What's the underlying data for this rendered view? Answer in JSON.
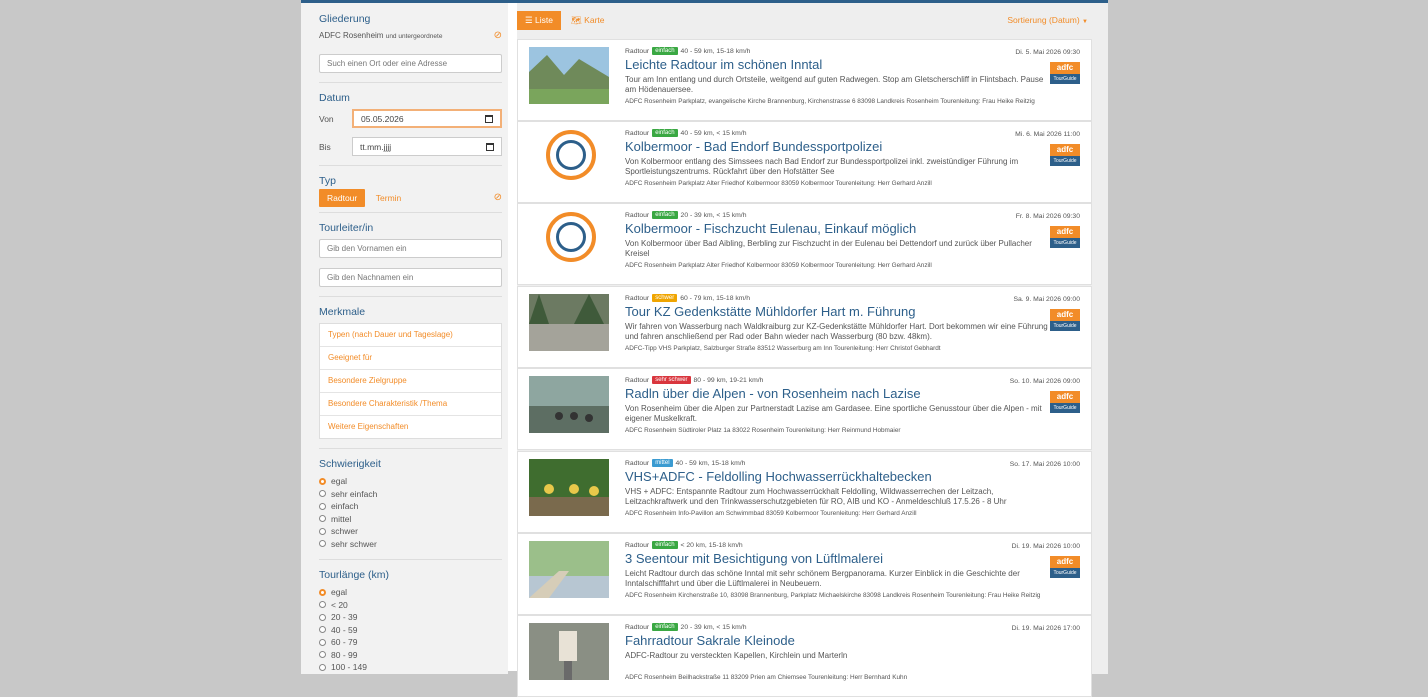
{
  "sidebar": {
    "gliederung_title": "Gliederung",
    "gliederung_value": "ADFC Rosenheim",
    "gliederung_sub": "und untergeordnete",
    "search_placeholder": "Such einen Ort oder eine Adresse",
    "datum_title": "Datum",
    "von_label": "Von",
    "von_value": "05.05.2026",
    "bis_label": "Bis",
    "bis_value": "tt.mm.jjjj",
    "typ_title": "Typ",
    "typ_radtour": "Radtour",
    "typ_termin": "Termin",
    "tourleiter_title": "Tourleiter/in",
    "vorname_placeholder": "Gib den Vornamen ein",
    "nachname_placeholder": "Gib den Nachnamen ein",
    "merkmale_title": "Merkmale",
    "merkmale": [
      "Typen (nach Dauer und Tageslage)",
      "Geeignet für",
      "Besondere Zielgruppe",
      "Besondere Charakteristik /Thema",
      "Weitere Eigenschaften"
    ],
    "schwierigkeit_title": "Schwierigkeit",
    "schwierigkeit": [
      "egal",
      "sehr einfach",
      "einfach",
      "mittel",
      "schwer",
      "sehr schwer"
    ],
    "tourlaenge_title": "Tourlänge (km)",
    "tourlaenge": [
      "egal",
      "< 20",
      "20 - 39",
      "40 - 59",
      "60 - 79",
      "80 - 99",
      "100 - 149"
    ]
  },
  "toolbar": {
    "liste": "Liste",
    "karte": "Karte",
    "sort": "Sortierung (Datum)"
  },
  "tours": [
    {
      "type": "Radtour",
      "badge": "einfach",
      "badge_color": "#3aa843",
      "stats": "40 - 59 km, 15-18 km/h",
      "date": "Di. 5. Mai 2026 09:30",
      "title": "Leichte Radtour im schönen Inntal",
      "desc": "Tour am Inn entlang und durch Ortsteile, weitgend auf guten Radwegen. Stop am Gletscherschliff in Flintsbach. Pause am Hödenauersee.",
      "foot": "ADFC Rosenheim Parkplatz, evangelische Kirche Brannenburg, Kirchenstrasse 6 83098 Landkreis Rosenheim Tourenleitung: Frau Heike Reitzig",
      "img": "mountain",
      "guide": true
    },
    {
      "type": "Radtour",
      "badge": "einfach",
      "badge_color": "#3aa843",
      "stats": "40 - 59 km, < 15 km/h",
      "date": "Mi. 6. Mai 2026 11:00",
      "title": "Kolbermoor - Bad Endorf Bundessportpolizei",
      "desc": "Von Kolbermoor entlang des Simssees nach Bad Endorf zur Bundessportpolizei inkl. zweistündiger Führung im Sportleistungszentrums. Rückfahrt über den Hofstätter See",
      "foot": "ADFC Rosenheim Parkplatz Alter Friedhof Kolbermoor 83059 Kolbermoor Tourenleitung: Herr Gerhard Anzill",
      "img": "logo",
      "guide": true
    },
    {
      "type": "Radtour",
      "badge": "einfach",
      "badge_color": "#3aa843",
      "stats": "20 - 39 km, < 15 km/h",
      "date": "Fr. 8. Mai 2026 09:30",
      "title": "Kolbermoor - Fischzucht Eulenau, Einkauf möglich",
      "desc": "Von Kolbermoor über Bad Aibling, Berbling zur Fischzucht in der Eulenau bei Dettendorf und zurück über Pullacher Kreisel",
      "foot": "ADFC Rosenheim Parkplatz Alter Friedhof Kolbermoor 83059 Kolbermoor Tourenleitung: Herr Gerhard Anzill",
      "img": "logo",
      "guide": true
    },
    {
      "type": "Radtour",
      "badge": "schwer",
      "badge_color": "#f0a500",
      "stats": "60 - 79 km, 15-18 km/h",
      "date": "Sa. 9. Mai 2026 09:00",
      "title": "Tour KZ Gedenkstätte Mühldorfer Hart m. Führung",
      "desc": "Wir fahren von Wasserburg nach Waldkraiburg zur KZ-Gedenkstätte Mühldorfer Hart. Dort bekommen wir eine Führung und fahren anschließend per Rad oder Bahn wieder nach Wasserburg (80 bzw. 48km).",
      "foot": "ADFC-Tipp VHS Parkplatz, Salzburger Straße 83512 Wasserburg am Inn Tourenleitung: Herr Christof Gebhardt",
      "img": "forest",
      "guide": true
    },
    {
      "type": "Radtour",
      "badge": "sehr schwer",
      "badge_color": "#d9363e",
      "stats": "80 - 99 km, 19-21 km/h",
      "date": "So. 10. Mai 2026 09:00",
      "title": "Radln über die Alpen - von Rosenheim nach Lazise",
      "desc": "Von Rosenheim über die Alpen zur Partnerstadt Lazise am Gardasee. Eine sportliche Genusstour über die Alpen - mit eigener Muskelkraft.",
      "foot": "ADFC Rosenheim Südtiroler Platz 1a 83022 Rosenheim Tourenleitung: Herr Reinmund Hobmaier",
      "img": "cyclists",
      "guide": true
    },
    {
      "type": "Radtour",
      "badge": "mittel",
      "badge_color": "#3b9bd1",
      "stats": "40 - 59 km, 15-18 km/h",
      "date": "So. 17. Mai 2026 10:00",
      "title": "VHS+ADFC - Feldolling Hochwasserrückhaltebecken",
      "desc": "VHS + ADFC: Entspannte Radtour zum Hochwasserrückhalt Feldolling, Wildwasserrechen der Leitzach, Leitzachkraftwerk und den Trinkwasserschutzgebieten für RO, AIB und KO - Anmeldeschluß 17.5.26 - 8 Uhr",
      "foot": "ADFC Rosenheim Info-Pavillon am Schwimmbad 83059 Kolbermoor Tourenleitung: Herr Gerhard Anzill",
      "img": "group",
      "guide": false
    },
    {
      "type": "Radtour",
      "badge": "einfach",
      "badge_color": "#3aa843",
      "stats": "< 20 km, 15-18 km/h",
      "date": "Di. 19. Mai 2026 10:00",
      "title": "3 Seentour mit Besichtigung von Lüftlmalerei",
      "desc": "Leicht Radtour durch das schöne Inntal mit sehr schönem Bergpanorama. Kurzer Einblick in die Geschichte der Inntalschifffahrt und über die Lüftlmalerei in Neubeuern.",
      "foot": "ADFC Rosenheim Kirchenstraße 10, 83098 Brannenburg, Parkplatz Michaelskirche 83098 Landkreis Rosenheim Tourenleitung: Frau Heike Reitzig",
      "img": "path",
      "guide": true
    },
    {
      "type": "Radtour",
      "badge": "einfach",
      "badge_color": "#3aa843",
      "stats": "20 - 39 km, < 15 km/h",
      "date": "Di. 19. Mai 2026 17:00",
      "title": "Fahrradtour Sakrale Kleinode",
      "desc": "ADFC-Radtour zu versteckten Kapellen, Kirchlein und Marterln",
      "foot": "ADFC Rosenheim Beilhackstraße 11 83209 Prien am Chiemsee Tourenleitung: Herr Bernhard Kuhn",
      "img": "shrine",
      "guide": false
    }
  ],
  "adfc_logo": {
    "top": "adfc",
    "bottom": "TourGuide"
  }
}
